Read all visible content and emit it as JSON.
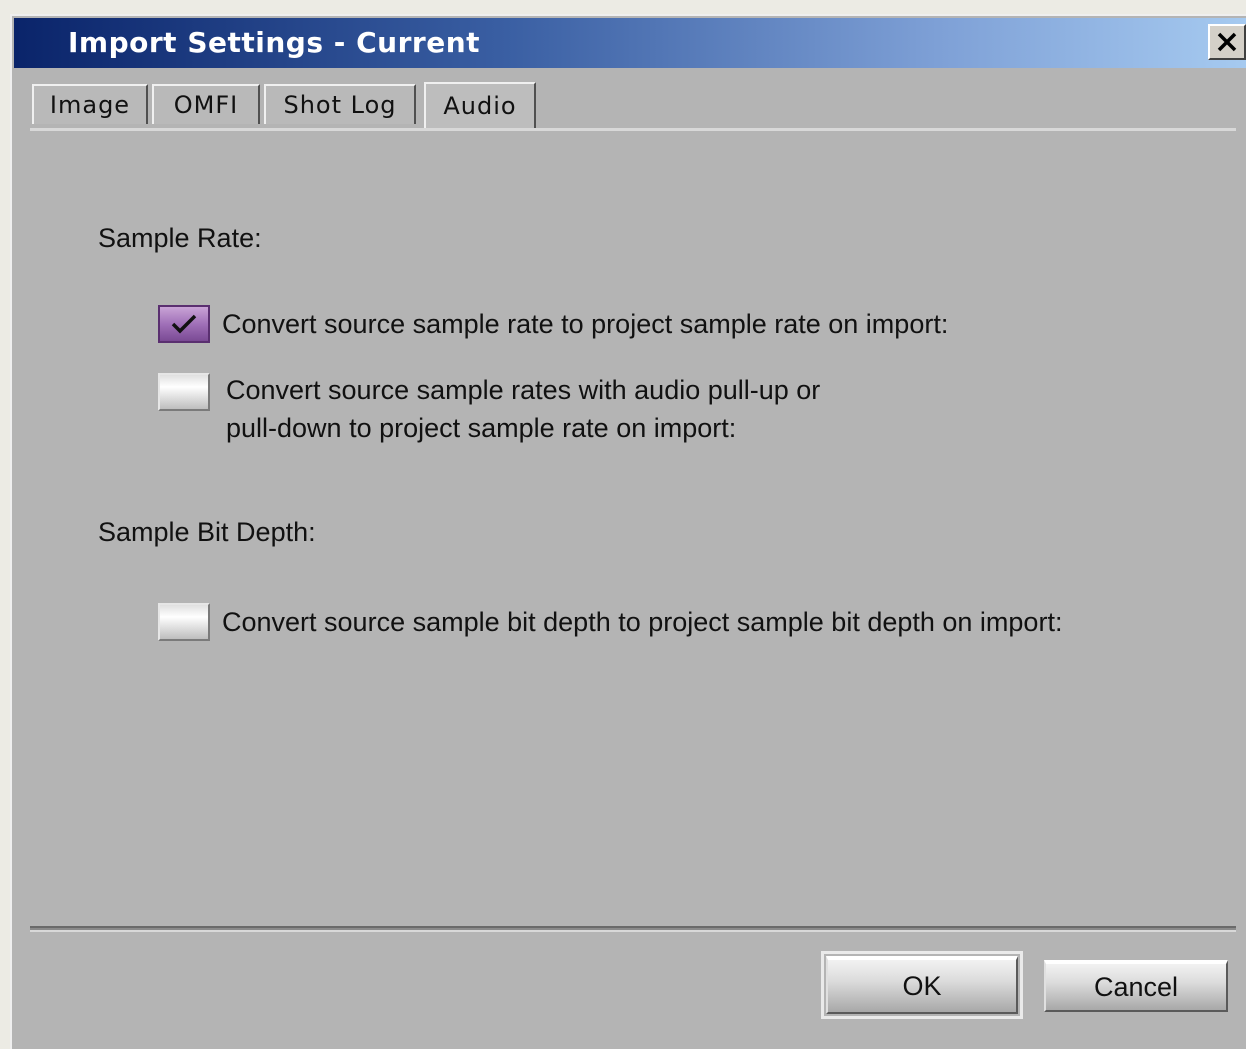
{
  "window": {
    "title": "Import Settings - Current"
  },
  "tabs": [
    {
      "label": "Image",
      "active": false
    },
    {
      "label": "OMFI",
      "active": false
    },
    {
      "label": "Shot Log",
      "active": false
    },
    {
      "label": "Audio",
      "active": true
    }
  ],
  "sample_rate": {
    "label": "Sample Rate:",
    "options": [
      {
        "line1": "Convert source sample rate to project sample rate on import:",
        "line2": "",
        "checked": true
      },
      {
        "line1": "Convert source sample rates with audio pull-up or",
        "line2": "pull-down to project sample rate on import:",
        "checked": false
      }
    ]
  },
  "bit_depth": {
    "label": "Sample Bit Depth:",
    "options": [
      {
        "line1": "Convert source sample bit depth to project sample bit depth on import:",
        "checked": false
      }
    ]
  },
  "buttons": {
    "ok": "OK",
    "cancel": "Cancel"
  },
  "icons": {
    "close": "close-icon",
    "check": "check-icon"
  },
  "colors": {
    "title_start": "#0a246a",
    "title_end": "#a6caf0",
    "checkbox_checked": "#a070b8",
    "panel_bg": "#b4b4b4"
  }
}
